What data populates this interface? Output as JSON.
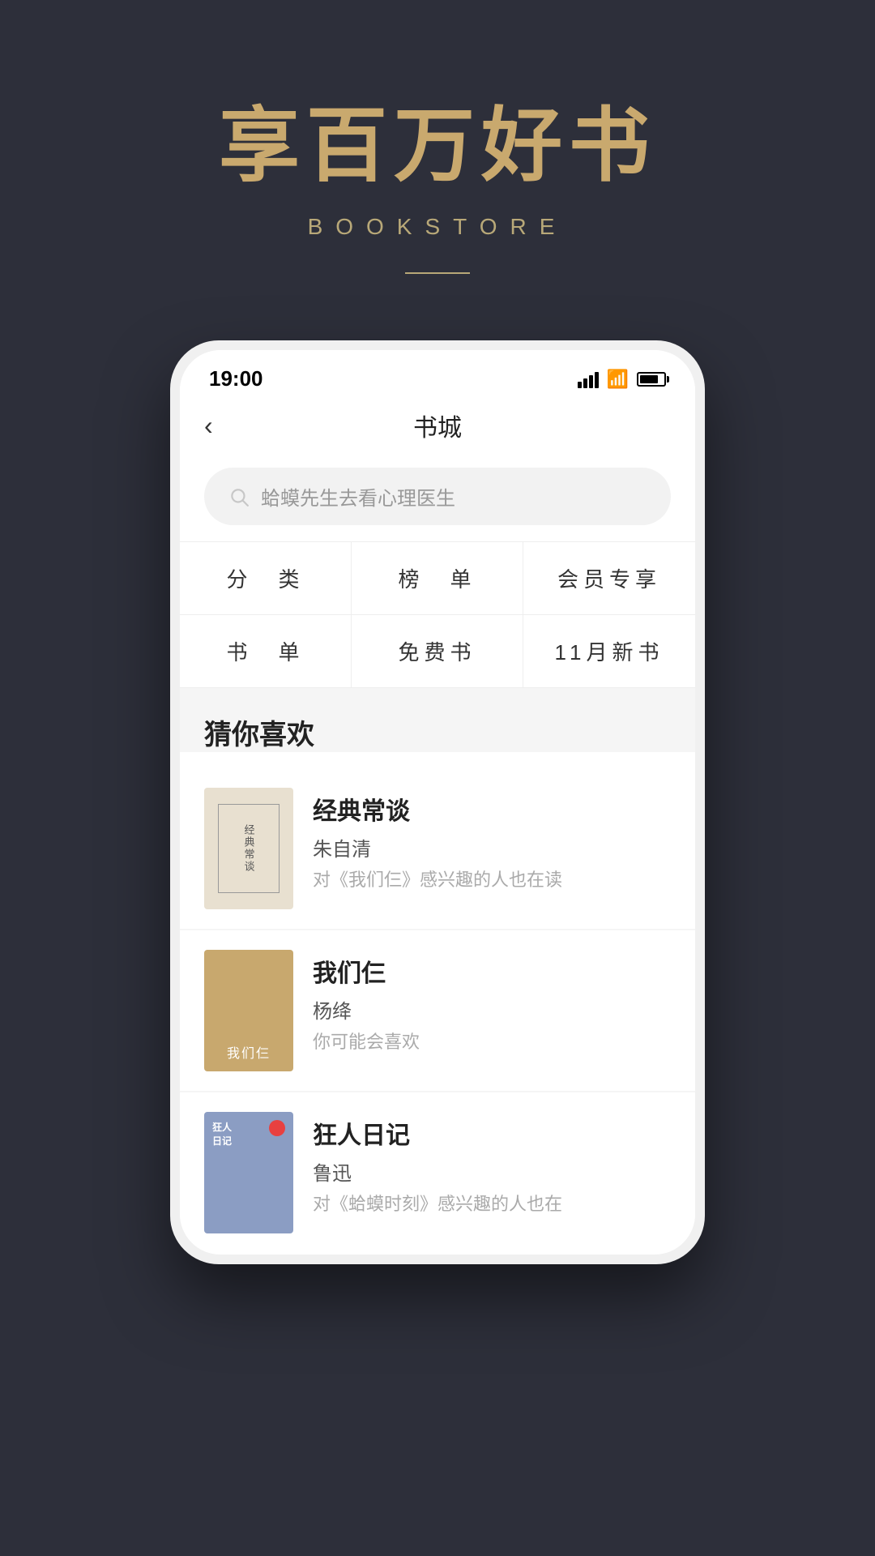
{
  "hero": {
    "title": "享百万好书",
    "subtitle": "BOOKSTORE"
  },
  "status_bar": {
    "time": "19:00"
  },
  "nav": {
    "back_label": "‹",
    "title": "书城"
  },
  "search": {
    "placeholder": "蛤蟆先生去看心理医生"
  },
  "categories": [
    {
      "label": "分　类"
    },
    {
      "label": "榜　单"
    },
    {
      "label": "会员专享"
    },
    {
      "label": "书　单"
    },
    {
      "label": "免费书"
    },
    {
      "label": "11月新书"
    }
  ],
  "section": {
    "title": "猜你喜欢"
  },
  "books": [
    {
      "title": "经典常谈",
      "author": "朱自清",
      "desc": "对《我们仨》感兴趣的人也在读",
      "cover_text": "经典常谈"
    },
    {
      "title": "我们仨",
      "author": "杨绛",
      "desc": "你可能会喜欢",
      "cover_text": "我们仨"
    },
    {
      "title": "狂人日记",
      "author": "鲁迅",
      "desc": "对《蛤蟆时刻》感兴趣的人也在",
      "cover_text": "狂人日记"
    }
  ]
}
